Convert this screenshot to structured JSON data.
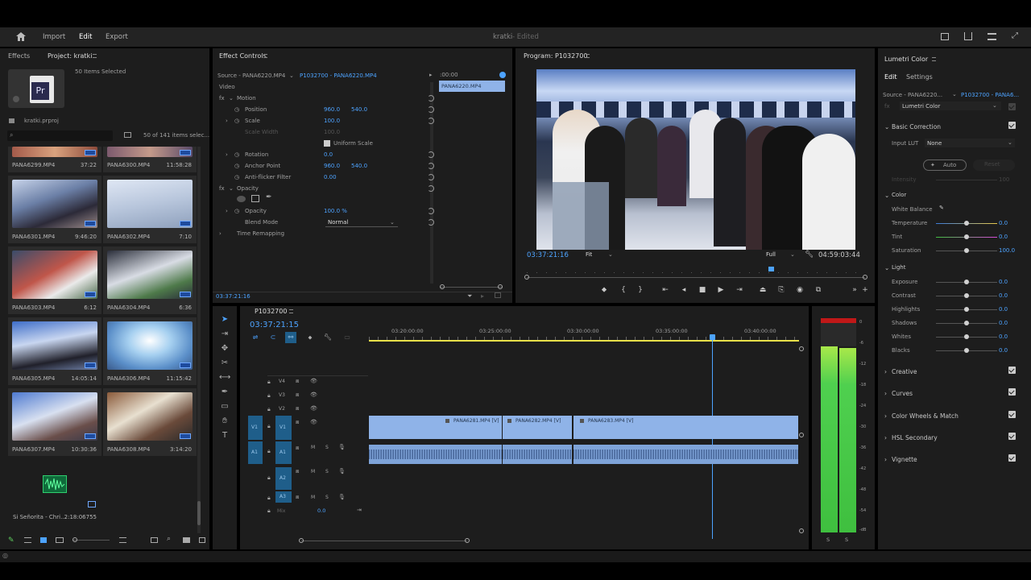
{
  "topbar": {
    "import": "Import",
    "edit": "Edit",
    "export": "Export",
    "title": "kratki",
    "edited": "- Edited"
  },
  "project": {
    "tab_effects": "Effects",
    "tab_project": "Project: kratki",
    "items_selected": "50 Items Selected",
    "file": "kratki.prproj",
    "count": "50 of 141 items selec...",
    "clips": [
      {
        "name": "PANA6299.MP4",
        "dur": "37:22"
      },
      {
        "name": "PANA6300.MP4",
        "dur": "11:58:28"
      },
      {
        "name": "PANA6301.MP4",
        "dur": "9:46:20"
      },
      {
        "name": "PANA6302.MP4",
        "dur": "7:10"
      },
      {
        "name": "PANA6303.MP4",
        "dur": "6:12"
      },
      {
        "name": "PANA6304.MP4",
        "dur": "6:36"
      },
      {
        "name": "PANA6305.MP4",
        "dur": "14:05:14"
      },
      {
        "name": "PANA6306.MP4",
        "dur": "11:15:42"
      },
      {
        "name": "PANA6307.MP4",
        "dur": "10:30:36"
      },
      {
        "name": "PANA6308.MP4",
        "dur": "3:14:20"
      }
    ],
    "audio": {
      "name": "Si Señorita - Chri...",
      "dur": "2:18:06755"
    }
  },
  "effects": {
    "tab": "Effect Controls",
    "source": "Source - PANA6220.MP4",
    "seq": "P1032700 - PANA6220.MP4",
    "time_head": ":00:00",
    "clip_label": "PANA6220.MP4",
    "video": "Video",
    "motion": "Motion",
    "position": "Position",
    "pos_x": "960.0",
    "pos_y": "540.0",
    "scale": "Scale",
    "scale_v": "100.0",
    "scale_width": "Scale Width",
    "scale_width_v": "100.0",
    "uniform": "Uniform Scale",
    "rotation": "Rotation",
    "rotation_v": "0.0",
    "anchor": "Anchor Point",
    "anch_x": "960.0",
    "anch_y": "540.0",
    "antiflicker": "Anti-flicker Filter",
    "antiflicker_v": "0.00",
    "opacity_group": "Opacity",
    "opacity": "Opacity",
    "opacity_v": "100.0 %",
    "blend": "Blend Mode",
    "blend_v": "Normal",
    "remap": "Time Remapping",
    "timecode": "03:37:21:16"
  },
  "program": {
    "tab": "Program: P1032700",
    "timecode": "03:37:21:16",
    "fit": "Fit",
    "full": "Full",
    "duration": "04:59:03:44"
  },
  "timeline": {
    "tab": "P1032700",
    "timecode": "03:37:21:15",
    "rulers": [
      "03:20:00:00",
      "03:25:00:00",
      "03:30:00:00",
      "03:35:00:00",
      "03:40:00:00"
    ],
    "tracks": [
      "V4",
      "V3",
      "V2",
      "V1",
      "A1",
      "A2",
      "A3"
    ],
    "mix": "Mix",
    "mix_v": "0.0",
    "clips": [
      "PANA6281.MP4 [V]",
      "PANA6282.MP4 [V]",
      "PANA6283.MP4 [V]"
    ]
  },
  "meter": {
    "ticks": [
      "0",
      "-6",
      "-12",
      "-18",
      "-24",
      "-30",
      "-36",
      "-42",
      "-48",
      "-54",
      "-dB"
    ],
    "s1": "S",
    "s2": "S"
  },
  "lumetri": {
    "tab": "Lumetri Color",
    "edit": "Edit",
    "settings": "Settings",
    "source": "Source - PANA6220...",
    "seq": "P1032700 - PANA6...",
    "effect": "Lumetri Color",
    "basic": "Basic Correction",
    "input_lut": "Input LUT",
    "lut_v": "None",
    "auto": "Auto",
    "reset": "Reset",
    "intensity": "Intensity",
    "intensity_v": "100",
    "color": "Color",
    "wb": "White Balance",
    "color_rows": [
      {
        "label": "Temperature",
        "value": "0.0"
      },
      {
        "label": "Tint",
        "value": "0.0"
      },
      {
        "label": "Saturation",
        "value": "100.0"
      }
    ],
    "light": "Light",
    "light_rows": [
      {
        "label": "Exposure",
        "value": "0.0"
      },
      {
        "label": "Contrast",
        "value": "0.0"
      },
      {
        "label": "Highlights",
        "value": "0.0"
      },
      {
        "label": "Shadows",
        "value": "0.0"
      },
      {
        "label": "Whites",
        "value": "0.0"
      },
      {
        "label": "Blacks",
        "value": "0.0"
      }
    ],
    "sections": [
      "Creative",
      "Curves",
      "Color Wheels & Match",
      "HSL Secondary",
      "Vignette"
    ]
  },
  "colors": {
    "accent": "#4da3ff",
    "clip": "#8fb3e8",
    "track": "#1f5e8a",
    "meter": "#3fbf3f"
  }
}
